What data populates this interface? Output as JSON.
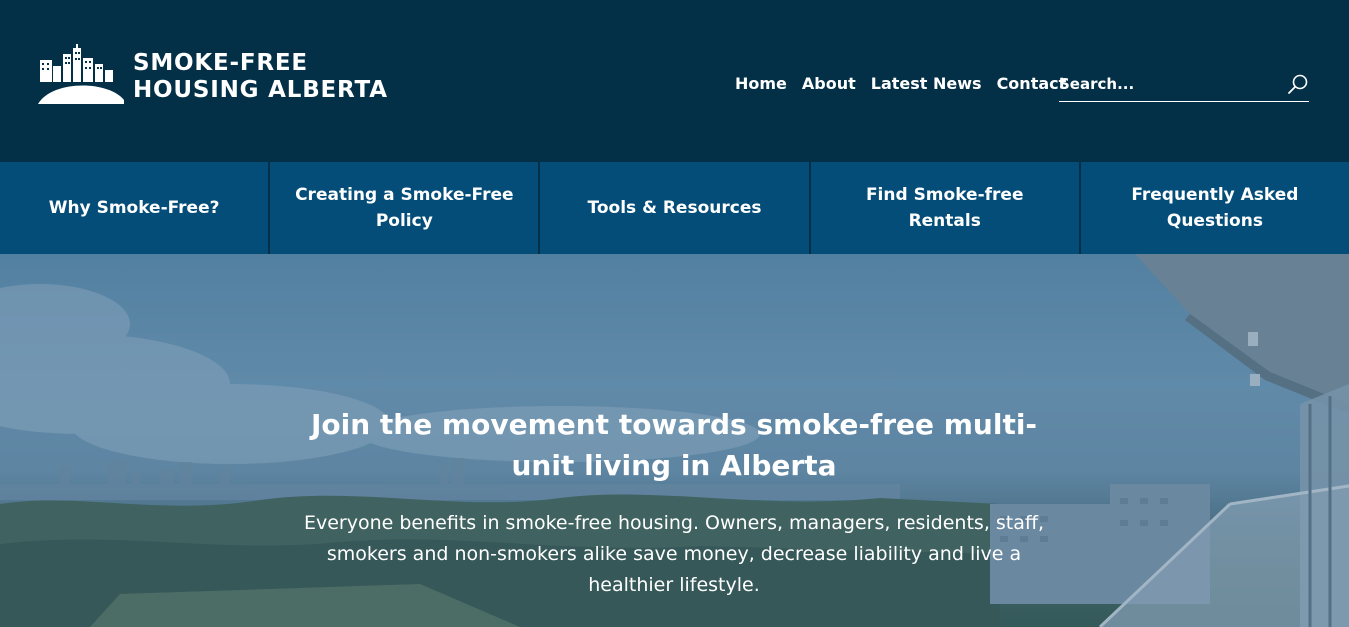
{
  "header": {
    "logo": {
      "line1": "SMOKE-FREE",
      "line2": "HOUSING ALBERTA"
    },
    "nav": [
      {
        "label": "Home"
      },
      {
        "label": "About"
      },
      {
        "label": "Latest News"
      },
      {
        "label": "Contact"
      }
    ],
    "search": {
      "placeholder": "Search...",
      "icon": "search-icon"
    }
  },
  "sub_nav": [
    {
      "label": "Why Smoke-Free?"
    },
    {
      "label": "Creating a Smoke-Free Policy"
    },
    {
      "label": "Tools & Resources"
    },
    {
      "label": "Find Smoke-free Rentals"
    },
    {
      "label": "Frequently Asked Questions"
    }
  ],
  "hero": {
    "title": "Join the movement towards smoke-free multi-unit living in Alberta",
    "subtitle": "Everyone benefits in smoke-free housing. Owners, managers, residents, staff, smokers and non-smokers alike save money, decrease liability and live a healthier lifestyle."
  },
  "colors": {
    "header_bg": "#033047",
    "subnav_bg": "#034d78",
    "text": "#ffffff"
  }
}
